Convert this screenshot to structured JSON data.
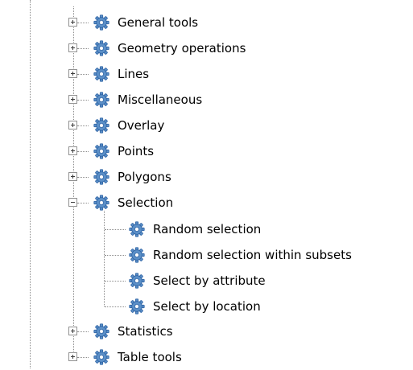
{
  "tree": {
    "groups": [
      {
        "label": "General tools",
        "expanded": false,
        "icon": "gear-icon"
      },
      {
        "label": "Geometry operations",
        "expanded": false,
        "icon": "gear-icon"
      },
      {
        "label": "Lines",
        "expanded": false,
        "icon": "gear-icon"
      },
      {
        "label": "Miscellaneous",
        "expanded": false,
        "icon": "gear-icon"
      },
      {
        "label": "Overlay",
        "expanded": false,
        "icon": "gear-icon"
      },
      {
        "label": "Points",
        "expanded": false,
        "icon": "gear-icon"
      },
      {
        "label": "Polygons",
        "expanded": false,
        "icon": "gear-icon"
      },
      {
        "label": "Selection",
        "expanded": true,
        "icon": "gear-icon",
        "children": [
          {
            "label": "Random selection",
            "icon": "gear-icon"
          },
          {
            "label": "Random selection within subsets",
            "icon": "gear-icon"
          },
          {
            "label": "Select by attribute",
            "icon": "gear-icon"
          },
          {
            "label": "Select by location",
            "icon": "gear-icon"
          }
        ]
      },
      {
        "label": "Statistics",
        "expanded": false,
        "icon": "gear-icon"
      },
      {
        "label": "Table tools",
        "expanded": false,
        "icon": "gear-icon"
      }
    ]
  },
  "colors": {
    "text": "#000000",
    "guide_line": "#8c8c8c",
    "gear_fill": "#5b8fc7",
    "gear_dark": "#2f64a5"
  }
}
